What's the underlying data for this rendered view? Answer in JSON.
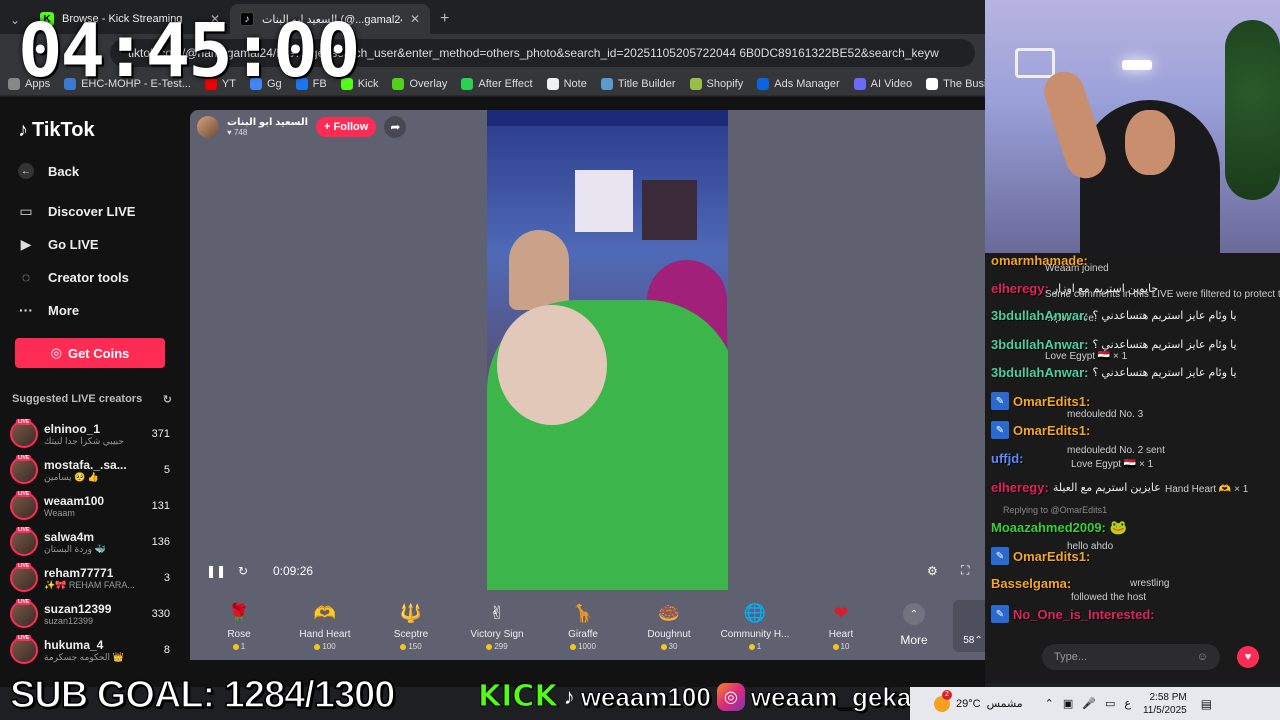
{
  "browser": {
    "tabs": [
      {
        "title": "Browse - Kick Streaming",
        "active": false
      },
      {
        "title": "السعيد ابو البنات (@...gamal24)",
        "active": true
      }
    ],
    "new_tab": "+",
    "url": "tiktok.com/@hamygamal24/live?...ge=search_user&enter_method=others_photo&search_id=20251105205722044 6B0DC89161322BE52&search_keyw",
    "bookmarks": [
      "Apps",
      "EHC-MOHP - E-Test...",
      "YT",
      "Gg",
      "FB",
      "Kick",
      "Overlay",
      "After Effect",
      "Note",
      "Title Builder",
      "Shopify",
      "Ads Manager",
      "AI Video",
      "The Busin"
    ]
  },
  "timer": "04:45:00",
  "tiktok": {
    "logo": "TikTok",
    "nav": {
      "back": "Back",
      "discover": "Discover LIVE",
      "go_live": "Go LIVE",
      "creator_tools": "Creator tools",
      "more": "More"
    },
    "get_coins": "Get Coins",
    "suggested_title": "Suggested LIVE creators",
    "creators": [
      {
        "name": "elninoo_1",
        "sub": "حبيبي شكرا جدا لنيتك",
        "count": "371"
      },
      {
        "name": "mostafa._.sa...",
        "sub": "يسامين 🥺 👍",
        "count": "5"
      },
      {
        "name": "weaam100",
        "sub": "Weaam",
        "count": "131"
      },
      {
        "name": "salwa4m",
        "sub": "وردة البستان 🐳",
        "count": "136"
      },
      {
        "name": "reham77771",
        "sub": "✨🎀 REHAM FARA...",
        "count": "3"
      },
      {
        "name": "suzan12399",
        "sub": "suzan12399",
        "count": "330"
      },
      {
        "name": "hukuma_4",
        "sub": "الحكومه جسكرمة 👑",
        "count": "8"
      }
    ]
  },
  "player": {
    "host_name": "السعيد ابو البنات",
    "host_views": "748",
    "follow": "+ Follow",
    "elapsed": "0:09:26"
  },
  "gifts": [
    {
      "name": "Rose",
      "price": "1",
      "icon": "🌹",
      "color": "#3a3a48"
    },
    {
      "name": "Hand Heart",
      "price": "100",
      "icon": "🫶",
      "color": "#3a3a48"
    },
    {
      "name": "Sceptre",
      "price": "150",
      "icon": "🔱",
      "color": "#3a3a48"
    },
    {
      "name": "Victory Sign",
      "price": "299",
      "icon": "✌",
      "color": "#3a3a48"
    },
    {
      "name": "Giraffe",
      "price": "1000",
      "icon": "🦒",
      "color": "#3a3a48"
    },
    {
      "name": "Doughnut",
      "price": "30",
      "icon": "🍩",
      "color": "#3a3a48"
    },
    {
      "name": "Community H...",
      "price": "1",
      "icon": "🌐",
      "color": "#3a3a48"
    },
    {
      "name": "Heart",
      "price": "10",
      "icon": "❤",
      "color": "#3a3a48"
    }
  ],
  "gifts_more": "More",
  "coin_balance": "58",
  "chat": {
    "messages": [
      {
        "user": "omarmhamade:",
        "color": "#f5a623",
        "text": ""
      },
      {
        "user": "elheregy:",
        "color": "#e0245e",
        "text": "جابوين استريم مع اوزار"
      },
      {
        "user": "3bdullahAnwar:",
        "color": "#4cd0a0",
        "text": "يا وئام عايز استريم هتساعدني ؟"
      },
      {
        "user": "3bdullahAnwar:",
        "color": "#4cd0a0",
        "text": "يا وئام عايز استريم هتساعدني ؟"
      },
      {
        "user": "3bdullahAnwar:",
        "color": "#4cd0a0",
        "text": "يا وئام عايز استريم هتساعدني ؟"
      },
      {
        "user": "OmarEdits1:",
        "color": "#f5a623",
        "text": ""
      },
      {
        "user": "OmarEdits1:",
        "color": "#f5a623",
        "text": ""
      },
      {
        "user": "uffjd:",
        "color": "#5b8cff",
        "text": ""
      },
      {
        "user": "elheregy:",
        "color": "#e0245e",
        "text": "عايزين استريم مع العيلة"
      },
      {
        "user": "Moaazahmed2009:",
        "color": "#3ad03a",
        "text": ""
      },
      {
        "user": "OmarEdits1:",
        "color": "#f5a623",
        "text": ""
      },
      {
        "user": "Basselgama:",
        "color": "#f5a623",
        "text": ""
      },
      {
        "user": "No_One_is_Interested:",
        "color": "#e0245e",
        "text": ""
      }
    ],
    "system": [
      "Weaam joined",
      "Some comments in this LIVE were filtered to protect the community's",
      "experience.",
      "Love Egypt 🇪🇬 × 1",
      "medouledd  No. 3",
      "medouledd  No. 2  sent",
      "Love Egypt 🇪🇬 × 1",
      "Hand Heart 🫶 × 1",
      "Replying to @OmarEdits1",
      "hello ahdo",
      "wrestling",
      "followed the host"
    ],
    "input_placeholder": "Type..."
  },
  "overlay": {
    "sub_goal": "SUB GOAL: 1284/1300",
    "kick": "KICK",
    "tiktok_handle": "weaam100",
    "ig_handle": "weaam_geka"
  },
  "taskbar": {
    "temp": "29°C",
    "weather": "مشمس",
    "badge": "2",
    "lang": "ع",
    "time": "2:58 PM",
    "date": "11/5/2025"
  }
}
